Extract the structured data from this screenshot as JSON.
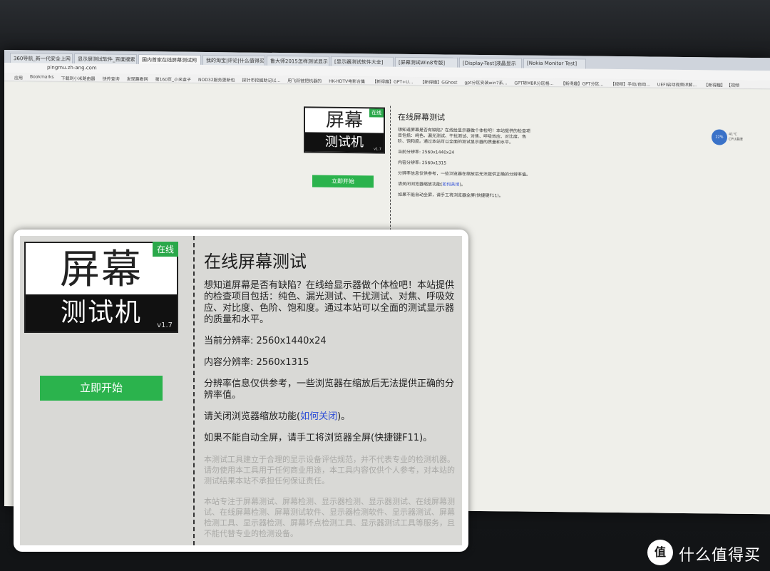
{
  "browser": {
    "tabs": [
      "360导航_新一代安全上网",
      "显示屏测试软件_百度搜索",
      "国内首家在线屏幕测试网",
      "我的淘宝|评论|什么值得买",
      "鲁大师2015怎样测试显示",
      "[显示器测试软件大全]",
      "[屏幕测试Win8专版]",
      "[Display-Test]液晶显示",
      "[Nokia Monitor Test]"
    ],
    "active_tab": 2,
    "url": "pingmu.zh-ang.com",
    "bookmarks": [
      "应用",
      "Bookmarks",
      "下载到小米路由器",
      "快传查询",
      "发现趣看网",
      "第160页_小米盒子",
      "NOD32服务更新包",
      "探针币挖掘助记以...",
      "用飞跃链把机器的",
      "HK-HDTV电影合集",
      "【新得趣】GPT+U...",
      "【新得趣】GGhost",
      "gpt分区安装win7系...",
      "GPT转MBR分区格...",
      "【新得趣】GPT分区...",
      "【视频】手动/自动...",
      "UEFI启动视频详解...",
      "【新得趣】 【视频"
    ]
  },
  "logo": {
    "title": "屏幕",
    "subtitle": "测试机",
    "badge": "在线",
    "version": "v1.7"
  },
  "start_button": "立即开始",
  "info": {
    "heading": "在线屏幕测试",
    "intro": "想知道屏幕是否有缺陷？在线给显示器做个体检吧！本站提供的检查项目包括：纯色、漏光测试、干扰测试、对焦、呼吸效应、对比度、色阶、饱和度。通过本站可以全面的测试显示器的质量和水平。",
    "current_resolution": "当前分辨率: 2560x1440x24",
    "content_resolution": "内容分辨率: 2560x1315",
    "note": "分辨率信息仅供参考，一些浏览器在缩放后无法提供正确的分辨率值。",
    "zoom_prefix": "请关闭浏览器缩放功能(",
    "zoom_link": "如何关闭",
    "zoom_suffix": ")。",
    "fullscreen": "如果不能自动全屏，请手工将浏览器全屏(快捷键F11)。",
    "faded_1": "本测试工具建立于合理的显示设备评估规范，并不代表专业的检测机器。请勿使用本工具用于任何商业用途，本工具内容仅供个人参考，对本站的测试结果本站不承担任何保证责任。",
    "faded_2": "本站专注于屏幕测试、屏幕检测、显示器检测、显示器测试、在线屏幕测试、在线屏幕检测、屏幕测试软件、显示器检测软件、显示器测试、屏幕检测工具、显示器检测、屏幕坏点检测工具、显示器测试工具等服务，且不能代替专业的检测设备。"
  },
  "tray": {
    "temperature": "41℃",
    "temp_label": "CPU温度",
    "usage": "22%"
  },
  "watermark": {
    "icon": "值",
    "text": "什么值得买"
  }
}
